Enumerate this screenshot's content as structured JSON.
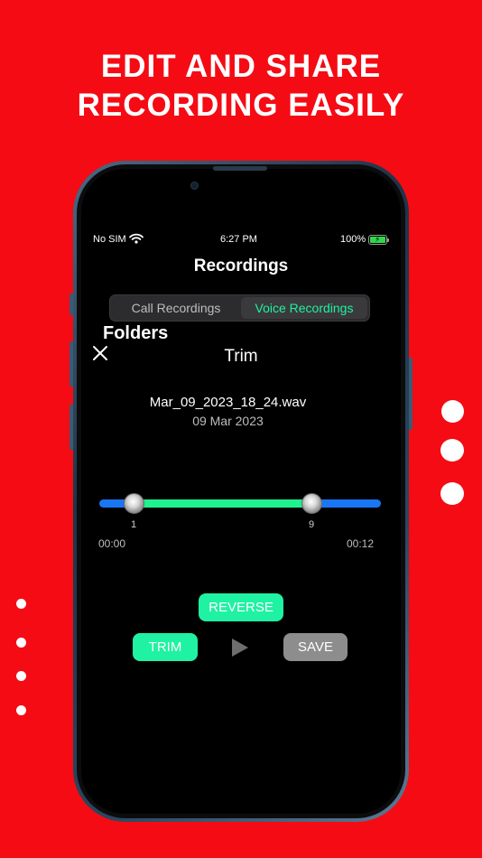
{
  "headline": {
    "line1": "EDIT AND SHARE",
    "line2": "RECORDING EASILY"
  },
  "status_bar": {
    "carrier": "No SIM",
    "time": "6:27 PM",
    "battery": "100%"
  },
  "screen": {
    "title": "Recordings",
    "segments": [
      "Call Recordings",
      "Voice Recordings"
    ],
    "selected_segment": "Voice Recordings",
    "folders_label": "Folders"
  },
  "trim_sheet": {
    "title": "Trim",
    "file_name": "Mar_09_2023_18_24.wav",
    "file_date": "09 Mar 2023",
    "range_start_label": "1",
    "range_end_label": "9",
    "start_time": "00:00",
    "end_time": "00:12",
    "reverse_label": "REVERSE",
    "trim_label": "TRIM",
    "save_label": "SAVE"
  },
  "colors": {
    "background": "#f50b14",
    "accent": "#1ff2a2",
    "track": "#1a76f2"
  },
  "icons": {
    "close": "close-icon",
    "play": "play-icon",
    "wifi": "wifi-icon",
    "battery": "battery-icon"
  }
}
